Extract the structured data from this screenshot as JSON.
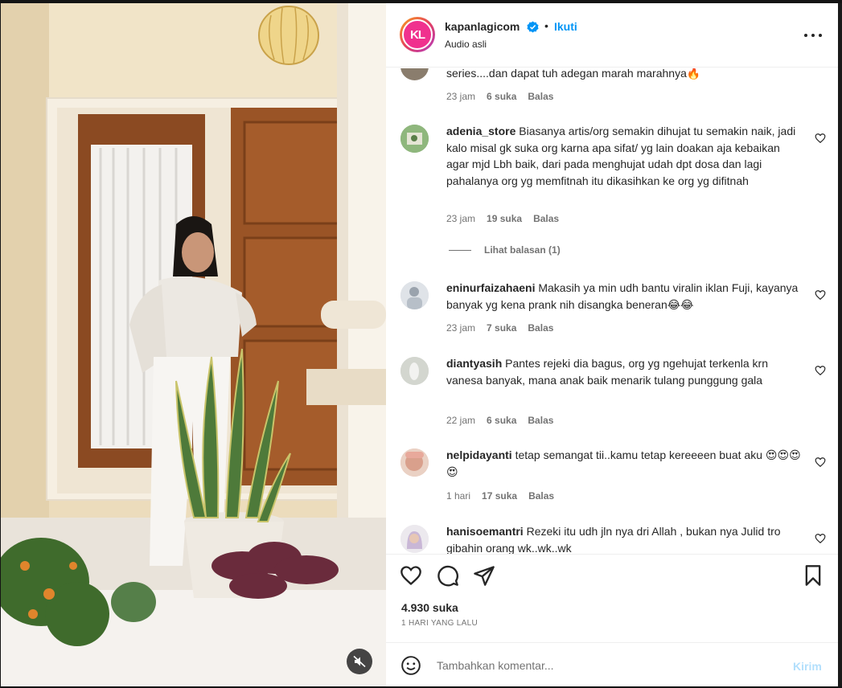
{
  "post": {
    "username": "kapanlagicom",
    "avatar_text": "KL",
    "follow_label": "Ikuti",
    "separator": "•",
    "subtitle": "Audio asli"
  },
  "comments": [
    {
      "username": "",
      "text": "series....dan dapat tuh adegan marah marahnya🔥",
      "time": "23 jam",
      "likes": "6 suka",
      "reply": "Balas"
    },
    {
      "username": "adenia_store",
      "text": "Biasanya artis/org semakin dihujat tu semakin naik, jadi kalo misal gk suka org karna apa sifat/ yg lain doakan aja kebaikan agar mjd Lbh baik, dari pada menghujat udah dpt dosa dan lagi pahalanya org yg memfitnah itu dikasihkan ke org yg difitnah",
      "time": "23 jam",
      "likes": "19 suka",
      "reply": "Balas",
      "view_replies": "Lihat balasan (1)"
    },
    {
      "username": "eninurfaizahaeni",
      "text": "Makasih ya min udh bantu viralin iklan Fuji, kayanya banyak yg kena prank nih disangka beneran😂😂",
      "time": "23 jam",
      "likes": "7 suka",
      "reply": "Balas"
    },
    {
      "username": "diantyasih",
      "text": "Pantes rejeki dia bagus, org yg ngehujat terkenla krn vanesa banyak, mana anak baik menarik tulang punggung gala",
      "time": "22 jam",
      "likes": "6 suka",
      "reply": "Balas"
    },
    {
      "username": "nelpidayanti",
      "text": "tetap semangat tii..kamu tetap kereeeen buat aku 😍😍😍😍",
      "time": "1 hari",
      "likes": "17 suka",
      "reply": "Balas"
    },
    {
      "username": "hanisoemantri",
      "text": "Rezeki itu udh jln nya dri Allah , bukan nya Julid tro gibahin orang wk..wk..wk",
      "time": "",
      "likes": "",
      "reply": ""
    }
  ],
  "stats": {
    "likes": "4.930 suka",
    "time_ago": "1 HARI YANG LALU"
  },
  "composer": {
    "placeholder": "Tambahkan komentar...",
    "post_label": "Kirim"
  },
  "icons": {
    "like": "heart-icon",
    "comment": "comment-icon",
    "share": "send-icon",
    "save": "bookmark-icon",
    "emoji": "emoji-icon",
    "mute": "speaker-muted-icon",
    "more": "more-options-icon",
    "verified": "verified-badge-icon"
  },
  "colors": {
    "accent": "#0095f6",
    "post_disabled": "#b2dffc",
    "muted_text": "#737373",
    "text": "#262626"
  }
}
